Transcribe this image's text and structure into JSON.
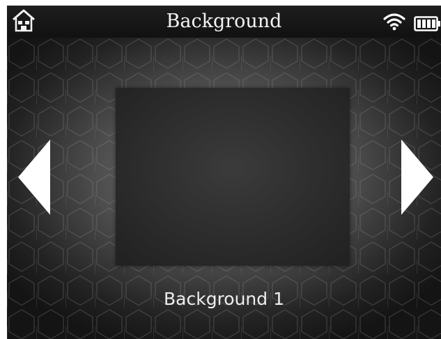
{
  "header": {
    "title": "Background",
    "home_icon": "home-icon",
    "wifi_icon": "wifi-icon",
    "battery_icon": "battery-icon"
  },
  "carousel": {
    "selected_label": "Background 1",
    "prev_icon": "left-arrow-icon",
    "next_icon": "right-arrow-icon"
  },
  "colors": {
    "text": "#f4f4f4",
    "arrow": "#ffffff",
    "header_bg": "#111111"
  }
}
